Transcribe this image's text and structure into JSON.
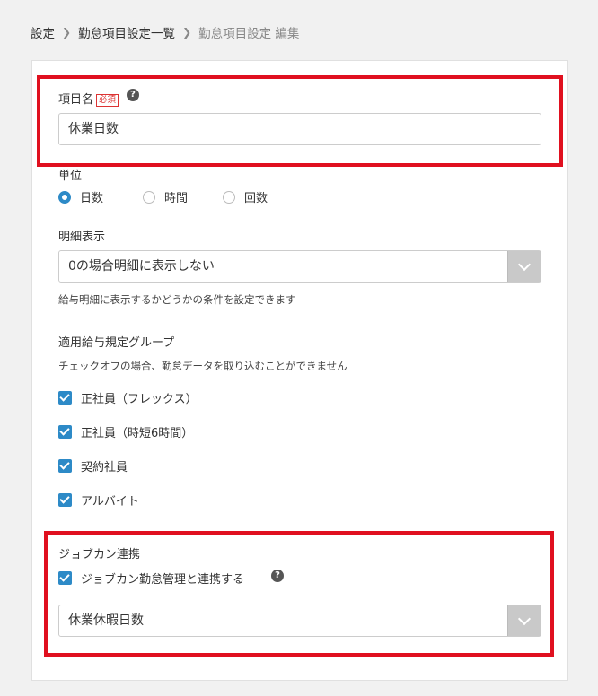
{
  "breadcrumb": {
    "items": [
      "設定",
      "勤怠項目設定一覧",
      "勤怠項目設定 編集"
    ]
  },
  "item_name": {
    "label": "項目名",
    "required_badge": "必須",
    "value": "休業日数"
  },
  "unit": {
    "label": "単位",
    "options": [
      "日数",
      "時間",
      "回数"
    ],
    "selected": "日数"
  },
  "detail_display": {
    "label": "明細表示",
    "value": "0の場合明細に表示しない",
    "note": "給与明細に表示するかどうかの条件を設定できます"
  },
  "groups": {
    "label": "適用給与規定グループ",
    "note": "チェックオフの場合、勤怠データを取り込むことができません",
    "items": [
      {
        "label": "正社員（フレックス）",
        "checked": true
      },
      {
        "label": "正社員（時短6時間）",
        "checked": true
      },
      {
        "label": "契約社員",
        "checked": true
      },
      {
        "label": "アルバイト",
        "checked": true
      }
    ]
  },
  "jobcan": {
    "label": "ジョブカン連携",
    "checkbox_label": "ジョブカン勤怠管理と連携する",
    "checked": true,
    "select_value": "休業休暇日数"
  },
  "colors": {
    "accent": "#2d8ac7",
    "highlight": "#e0101f"
  }
}
